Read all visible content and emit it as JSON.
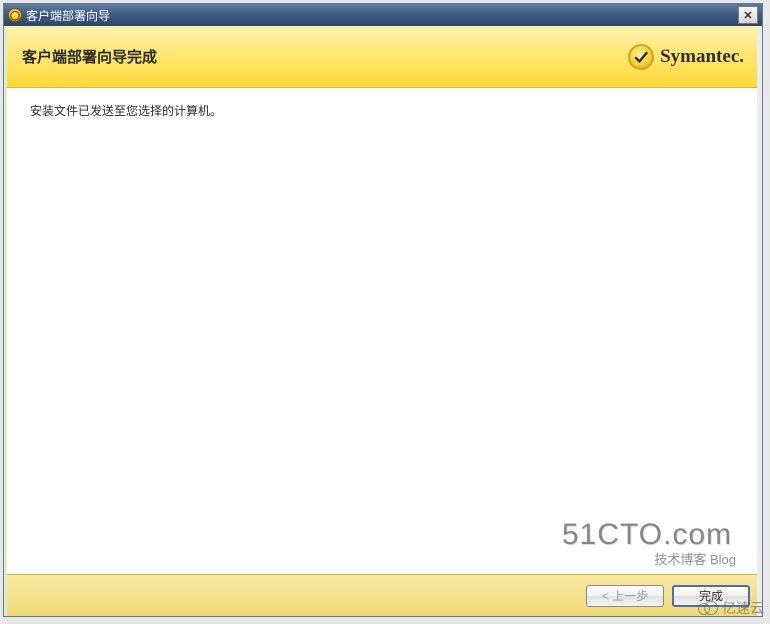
{
  "titlebar": {
    "title": "客户端部署向导"
  },
  "header": {
    "title": "客户端部署向导完成",
    "brand": "Symantec."
  },
  "content": {
    "body": "安装文件已发送至您选择的计算机。"
  },
  "footer": {
    "back_label": "< 上一步",
    "finish_label": "完成"
  },
  "watermark": {
    "main": "51CTO.com",
    "sub": "技术博客  Blog",
    "yisu": "亿速云"
  }
}
